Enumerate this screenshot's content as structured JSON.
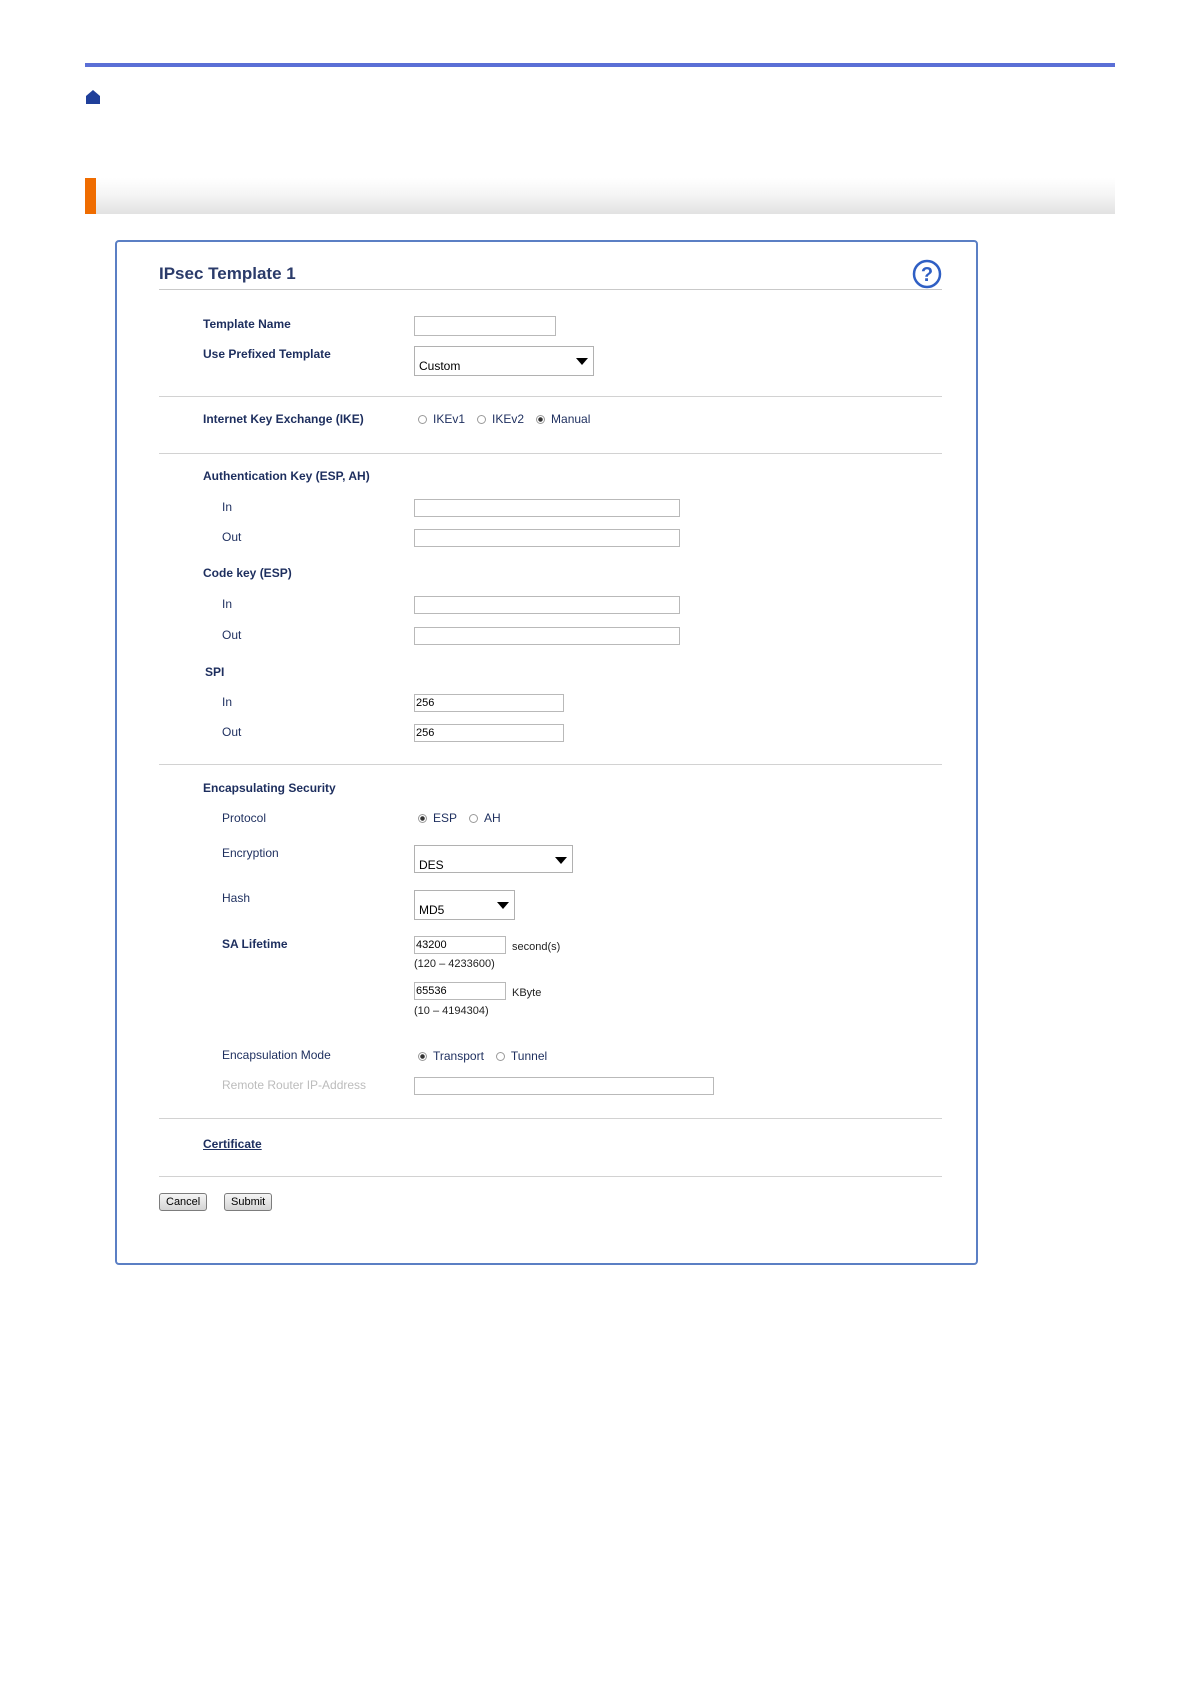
{
  "header": {
    "home_icon": "home-icon",
    "rule_color": "#5b6fd6",
    "accent_color": "#ef6c00"
  },
  "panel": {
    "title": "IPsec Template 1",
    "help_icon": "help-question-icon",
    "template_name": {
      "label": "Template Name",
      "value": ""
    },
    "prefixed_template": {
      "label": "Use Prefixed Template",
      "selected": "Custom"
    },
    "ike": {
      "label": "Internet Key Exchange (IKE)",
      "options": [
        "IKEv1",
        "IKEv2",
        "Manual"
      ],
      "selected": "Manual"
    },
    "auth_key": {
      "label": "Authentication Key (ESP, AH)",
      "in_label": "In",
      "in_value": "",
      "out_label": "Out",
      "out_value": ""
    },
    "code_key": {
      "label": "Code key (ESP)",
      "in_label": "In",
      "in_value": "",
      "out_label": "Out",
      "out_value": ""
    },
    "spi": {
      "label": "SPI",
      "in_label": "In",
      "in_value": "256",
      "out_label": "Out",
      "out_value": "256"
    },
    "encap": {
      "label": "Encapsulating Security",
      "protocol_label": "Protocol",
      "protocol_options": [
        "ESP",
        "AH"
      ],
      "protocol_selected": "ESP",
      "encryption_label": "Encryption",
      "encryption_selected": "DES",
      "hash_label": "Hash",
      "hash_selected": "MD5",
      "lifetime_label": "SA Lifetime",
      "lifetime_seconds": "43200",
      "seconds_unit": "second(s)",
      "seconds_range": "(120 – 4233600)",
      "lifetime_kbyte": "65536",
      "kbyte_unit": "KByte",
      "kbyte_range": "(10 – 4194304)",
      "mode_label": "Encapsulation Mode",
      "mode_options": [
        "Transport",
        "Tunnel"
      ],
      "mode_selected": "Transport",
      "remote_label": "Remote Router IP-Address",
      "remote_value": ""
    },
    "certificate_link": "Certificate",
    "cancel_label": "Cancel",
    "submit_label": "Submit"
  }
}
